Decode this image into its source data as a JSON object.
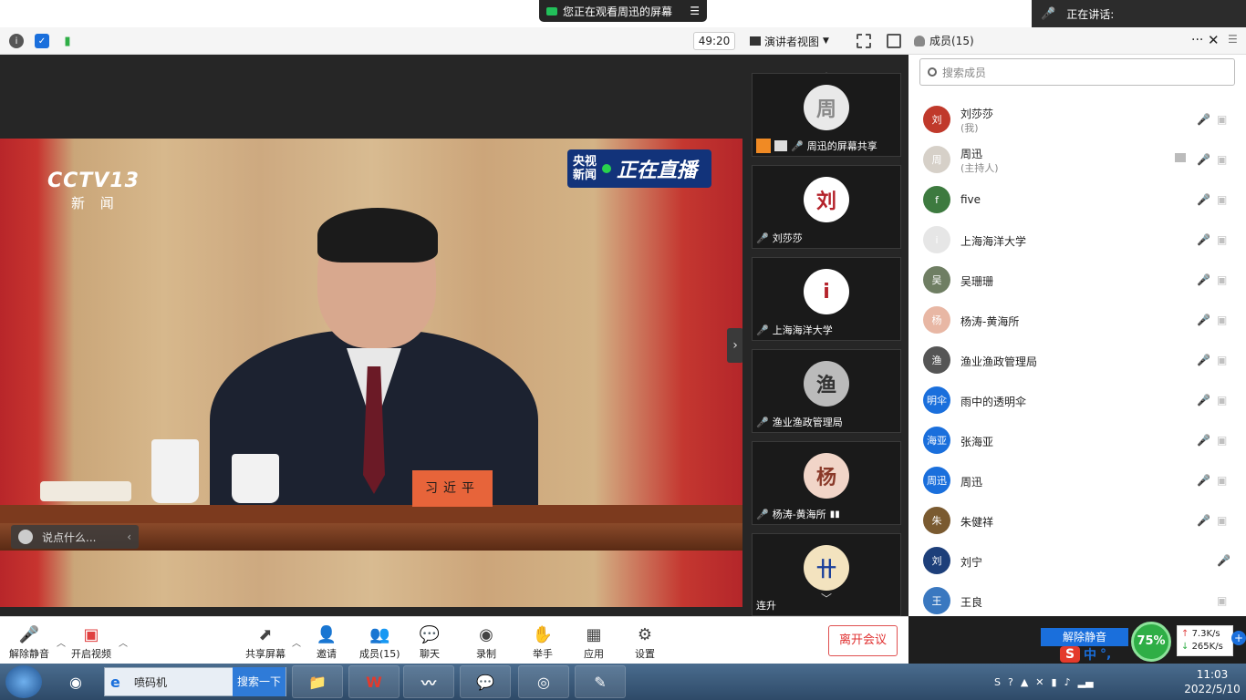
{
  "banner": {
    "share_notice": "您正在观看周迅的屏幕",
    "speaking_label": "正在讲话:"
  },
  "toolbar": {
    "timer": "49:20",
    "view_mode": "演讲者视图"
  },
  "members_header": {
    "title": "成员(15)"
  },
  "search": {
    "placeholder": "搜索成员"
  },
  "shared_screen": {
    "channel_logo": "CCTV13",
    "channel_sub": "新 闻",
    "live_small_top": "央视",
    "live_small_bottom": "新闻",
    "live_big": "正在直播",
    "nameplate": "习近平"
  },
  "chat": {
    "placeholder": "说点什么..."
  },
  "tiles": [
    {
      "label": "周迅的屏幕共享",
      "avatar": "周"
    },
    {
      "label": "刘莎莎",
      "avatar": "刘"
    },
    {
      "label": "上海海洋大学",
      "avatar": "ⅰ"
    },
    {
      "label": "渔业渔政管理局",
      "avatar": "渔"
    },
    {
      "label": "杨涛-黄海所",
      "avatar": "杨"
    },
    {
      "label": "连升",
      "avatar": "卄"
    }
  ],
  "members": [
    {
      "name": "刘莎莎",
      "sub": "(我)",
      "avatar": "刘",
      "color": "#c0392b"
    },
    {
      "name": "周迅",
      "sub": "(主持人)",
      "avatar": "周",
      "color": "#d6d0c8"
    },
    {
      "name": "five",
      "sub": "",
      "avatar": "f",
      "color": "#3d7a3f"
    },
    {
      "name": "上海海洋大学",
      "sub": "",
      "avatar": "ⅰ",
      "color": "#e6e6e6"
    },
    {
      "name": "吴珊珊",
      "sub": "",
      "avatar": "吴",
      "color": "#6f7e63"
    },
    {
      "name": "杨涛-黄海所",
      "sub": "",
      "avatar": "杨",
      "color": "#e8b7a4"
    },
    {
      "name": "渔业渔政管理局",
      "sub": "",
      "avatar": "渔",
      "color": "#555555"
    },
    {
      "name": "雨中的透明伞",
      "sub": "",
      "avatar": "明伞",
      "color": "#1a6fdc"
    },
    {
      "name": "张海亚",
      "sub": "",
      "avatar": "海亚",
      "color": "#1a6fdc"
    },
    {
      "name": "周迅",
      "sub": "",
      "avatar": "周迅",
      "color": "#1a6fdc"
    },
    {
      "name": "朱健祥",
      "sub": "",
      "avatar": "朱",
      "color": "#7a5a30"
    },
    {
      "name": "刘宁",
      "sub": "",
      "avatar": "刘",
      "color": "#1d3f7a"
    },
    {
      "name": "王良",
      "sub": "",
      "avatar": "王",
      "color": "#3a78c0"
    }
  ],
  "bottom_bar": {
    "unmute": "解除静音",
    "start_video": "开启视频",
    "share_screen": "共享屏幕",
    "invite": "邀请",
    "members": "成员(15)",
    "chat": "聊天",
    "record": "录制",
    "raise_hand": "举手",
    "apps": "应用",
    "settings": "设置",
    "leave": "离开会议"
  },
  "panel_unmute": "解除静音",
  "net": {
    "percent": "75%",
    "up": "7.3K/s",
    "down": "265K/s"
  },
  "ime": {
    "logo": "S",
    "lang": "中",
    "punct": "°,"
  },
  "taskbar": {
    "ie_query": "喷码机",
    "search_btn": "搜索一下",
    "wps": "W",
    "time": "11:03",
    "date": "2022/5/10"
  },
  "colors": {
    "accent_blue": "#1a6fdc",
    "mute_red": "#e04040",
    "leave_red": "#e03030",
    "net_green": "#2fae46"
  }
}
